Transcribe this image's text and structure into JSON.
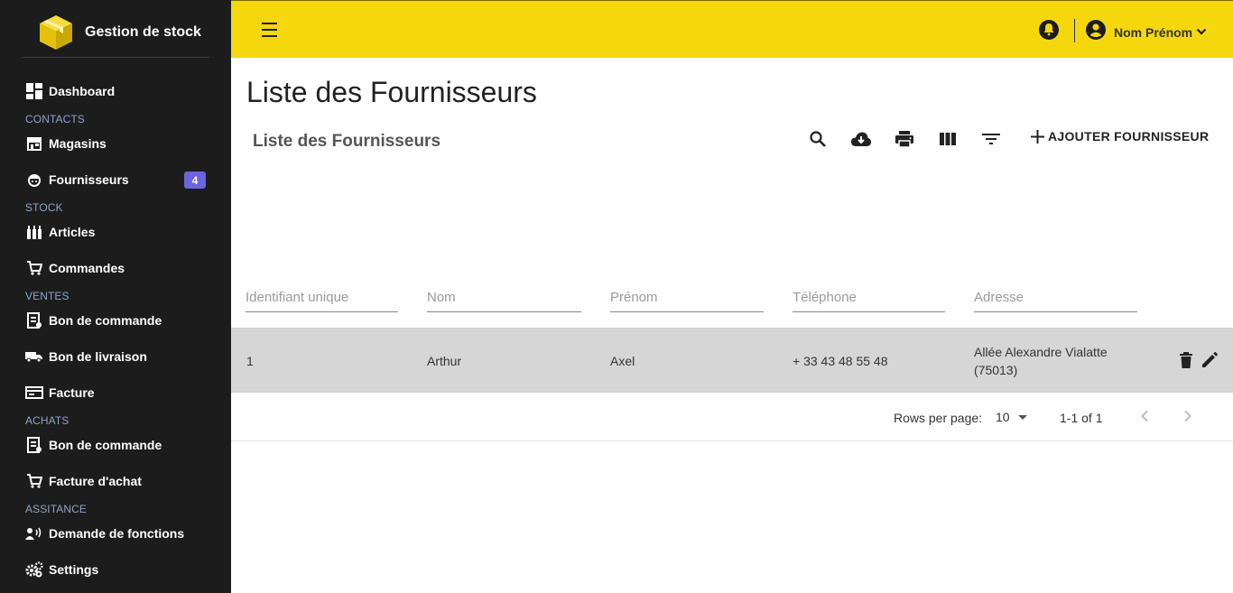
{
  "brand": {
    "title": "Gestion de stock",
    "logo_icon": "package-box-icon",
    "logo_color": "#f5d70e"
  },
  "sidebar": {
    "items": [
      {
        "label": "Dashboard"
      },
      {
        "section": "CONTACTS"
      },
      {
        "label": "Magasins"
      },
      {
        "label": "Fournisseurs",
        "badge": "4"
      },
      {
        "section": "STOCK"
      },
      {
        "label": "Articles"
      },
      {
        "label": "Commandes"
      },
      {
        "section": "VENTES"
      },
      {
        "label": "Bon de commande"
      },
      {
        "label": "Bon de livraison"
      },
      {
        "label": "Facture"
      },
      {
        "section": "ACHATS"
      },
      {
        "label": "Bon de commande"
      },
      {
        "label": "Facture d'achat"
      },
      {
        "section": "ASSITANCE"
      },
      {
        "label": "Demande de fonctions"
      },
      {
        "label": "Settings"
      }
    ]
  },
  "topbar": {
    "user_name": "Nom Prénom",
    "accent": "#f5d70e"
  },
  "page": {
    "title": "Liste des Fournisseurs"
  },
  "table": {
    "title": "Liste des Fournisseurs",
    "add_label": "AJOUTER FOURNISSEUR",
    "filters": [
      {
        "placeholder": "Identifiant unique"
      },
      {
        "placeholder": "Nom"
      },
      {
        "placeholder": "Prénom"
      },
      {
        "placeholder": "Téléphone"
      },
      {
        "placeholder": "Adresse"
      }
    ],
    "rows": [
      {
        "id": "1",
        "nom": "Arthur",
        "prenom": "Axel",
        "telephone": "+ 33 43 48 55 48",
        "adresse_line1": "Allée Alexandre Vialatte",
        "adresse_line2": "(75013)"
      }
    ],
    "pagination": {
      "rows_label": "Rows per page:",
      "rows_per_page": "10",
      "range": "1-1 of 1"
    }
  }
}
